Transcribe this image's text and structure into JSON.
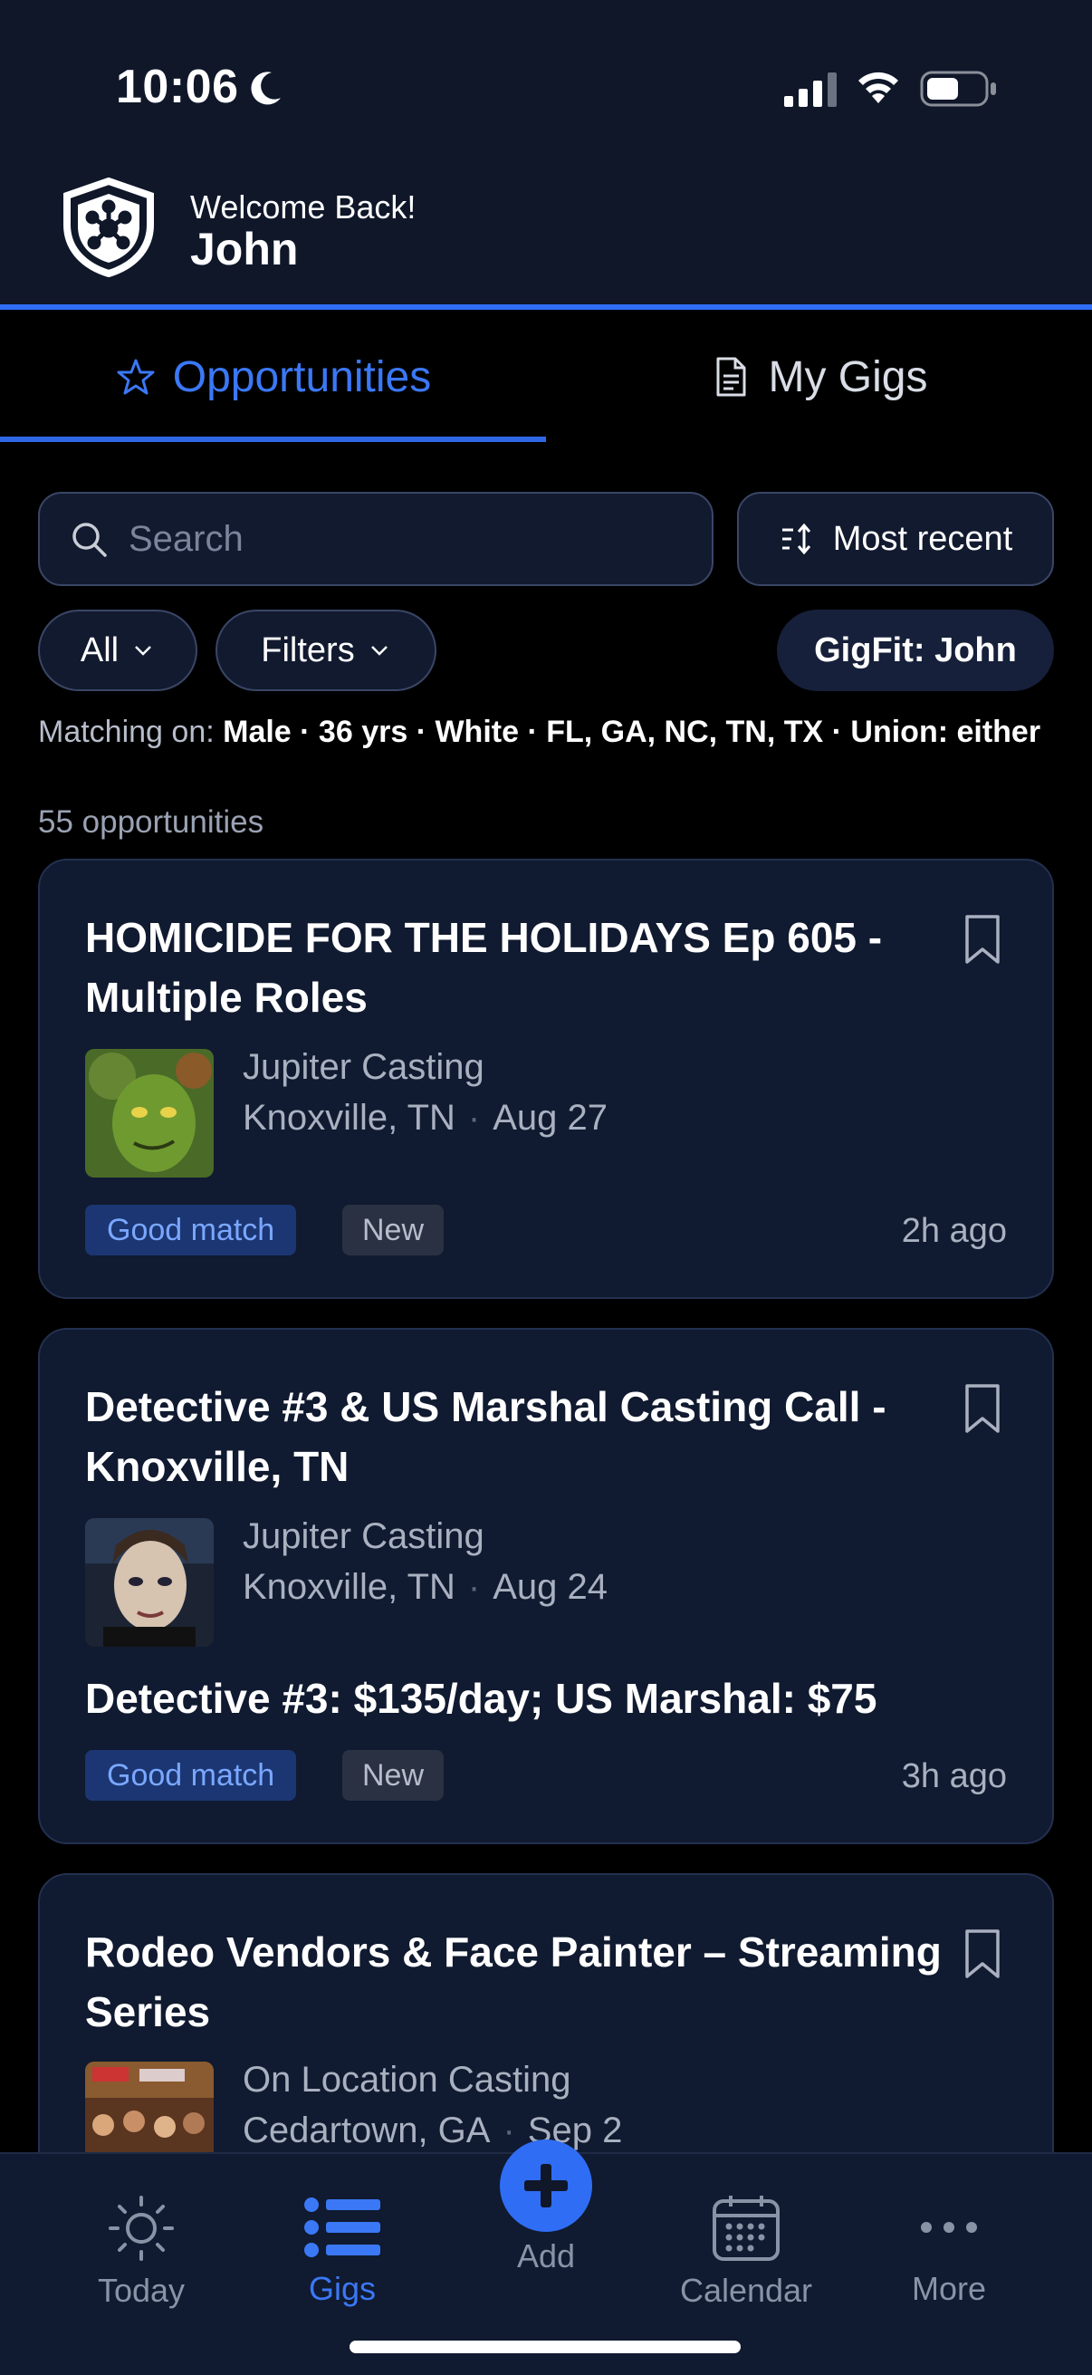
{
  "status_bar": {
    "time": "10:06"
  },
  "header": {
    "welcome": "Welcome Back!",
    "name": "John"
  },
  "tabs": [
    {
      "label": "Opportunities",
      "active": true
    },
    {
      "label": "My Gigs",
      "active": false
    }
  ],
  "search": {
    "placeholder": "Search"
  },
  "sort": {
    "label": "Most recent"
  },
  "filters": {
    "all_label": "All",
    "filters_label": "Filters",
    "gigfit_label": "GigFit: John"
  },
  "matching": {
    "prefix": "Matching on: ",
    "criteria": "Male · 36 yrs · White · FL, GA, NC, TN, TX · Union: either"
  },
  "count_text": "55 opportunities",
  "cards": [
    {
      "title": "HOMICIDE FOR THE HOLIDAYS Ep 605 - Multiple Roles",
      "company": "Jupiter Casting",
      "location": "Knoxville, TN",
      "date": "Aug 27",
      "pay": "",
      "match_badge": "Good match",
      "new_badge": "New",
      "ago": "2h ago",
      "thumb_icon": "green-character-photo"
    },
    {
      "title": "Detective #3 & US Marshal Casting Call - Knoxville, TN",
      "company": "Jupiter Casting",
      "location": "Knoxville, TN",
      "date": "Aug 24",
      "pay": "Detective #3: $135/day; US Marshal: $75",
      "match_badge": "Good match",
      "new_badge": "New",
      "ago": "3h ago",
      "thumb_icon": "portrait-photo"
    },
    {
      "title": "Rodeo Vendors & Face Painter – Streaming Series",
      "company": "On Location Casting",
      "location": "Cedartown, GA",
      "date": "Sep 2",
      "thumb_icon": "crowd-photo"
    }
  ],
  "bottom_nav": {
    "today": "Today",
    "gigs": "Gigs",
    "add": "Add",
    "calendar": "Calendar",
    "more": "More"
  },
  "colors": {
    "accent": "#2f6df5",
    "background": "#000000",
    "card": "#101a30",
    "header": "#0f1729"
  }
}
